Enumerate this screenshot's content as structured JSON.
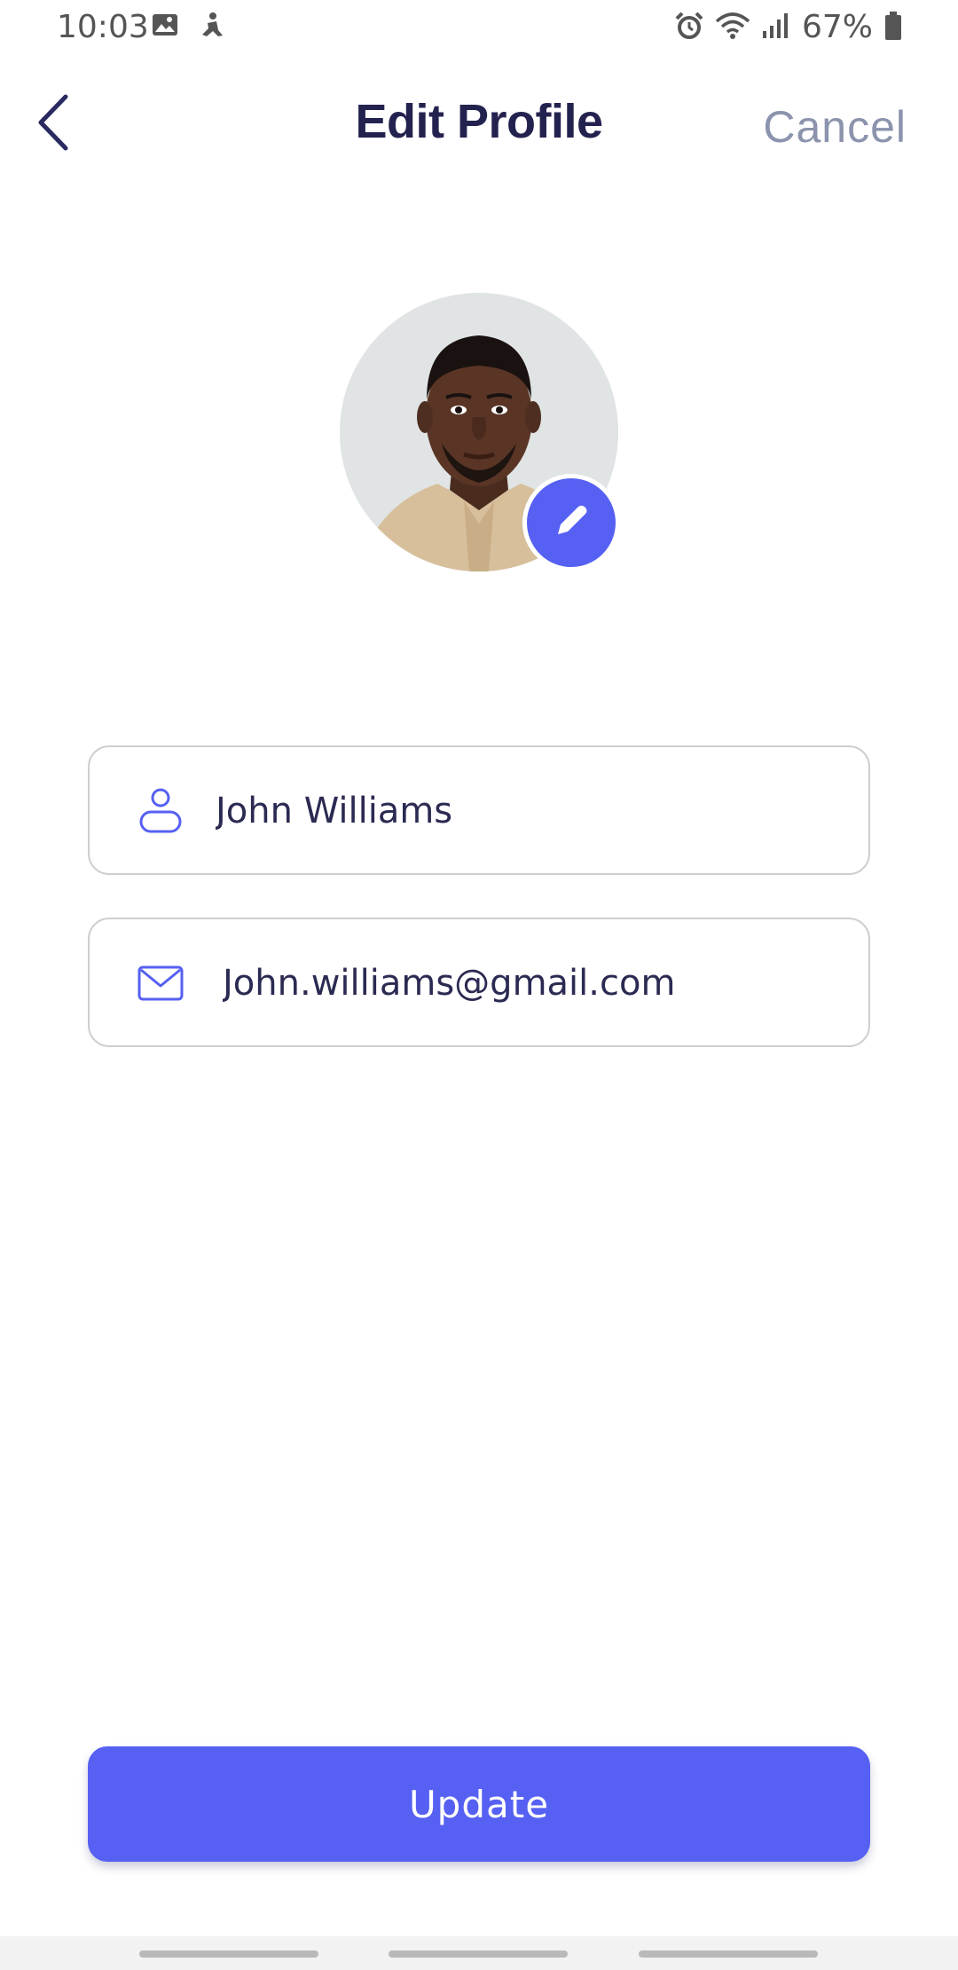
{
  "status_bar": {
    "time": "10:03",
    "battery_percent": "67%",
    "icons": [
      "image-icon",
      "activity-icon",
      "alarm-icon",
      "wifi-icon",
      "signal-icon",
      "battery-icon"
    ]
  },
  "header": {
    "title": "Edit Profile",
    "cancel_label": "Cancel",
    "back_icon": "chevron-left-icon"
  },
  "profile": {
    "avatar_icon": "avatar",
    "edit_icon": "pencil-icon"
  },
  "form": {
    "name_value": "John Williams",
    "name_icon": "user-icon",
    "email_value": "John.williams@gmail.com",
    "email_icon": "mail-icon"
  },
  "actions": {
    "update_label": "Update"
  },
  "colors": {
    "accent": "#5660f2",
    "title": "#23224f",
    "cancel": "#8b93ad",
    "input_border": "#cfcfd2",
    "input_text": "#2b2a52"
  }
}
